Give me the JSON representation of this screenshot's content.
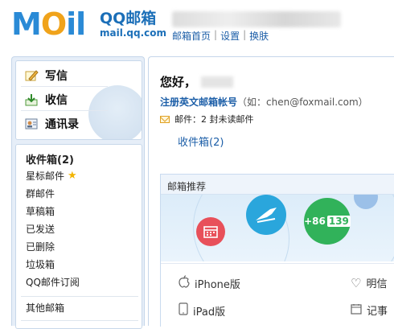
{
  "header": {
    "logo_text": "MOil",
    "brand": "QQ邮箱",
    "url": "mail.qq.com",
    "links": [
      "邮箱首页",
      "设置",
      "换肤"
    ],
    "link_sep": "|"
  },
  "sidebar": {
    "quick": [
      {
        "label": "写信",
        "icon": "pen-icon"
      },
      {
        "label": "收信",
        "icon": "inbox-download-icon"
      },
      {
        "label": "通讯录",
        "icon": "address-book-icon"
      }
    ],
    "folders": [
      {
        "label": "收件箱(2)"
      },
      {
        "label": "星标邮件",
        "icon": "star-icon"
      },
      {
        "label": "群邮件"
      },
      {
        "label": "草稿箱"
      },
      {
        "label": "已发送"
      },
      {
        "label": "已删除"
      },
      {
        "label": "垃圾箱"
      },
      {
        "label": "QQ邮件订阅"
      }
    ],
    "other": "其他邮箱"
  },
  "main": {
    "greeting": "您好，",
    "register": "注册英文邮箱帐号",
    "register_hint": "（如：chen@foxmail.com）",
    "unread": "邮件：2 封未读邮件",
    "inbox_link": "收件箱(2)",
    "panel_title": "邮箱推荐",
    "badge_text": "+86",
    "badge_num": "139",
    "apps": [
      {
        "label": "iPhone版",
        "icon": "apple-icon"
      },
      {
        "label": "明信",
        "icon": "heart-icon"
      },
      {
        "label": "iPad版",
        "icon": "tablet-icon"
      },
      {
        "label": "记事",
        "icon": "calendar-icon"
      }
    ]
  },
  "colors": {
    "accent": "#1d5fa8",
    "logo_blue": "#2a8ad6",
    "logo_orange": "#f0a31b",
    "sidebar_bg": "#e6eef8"
  }
}
